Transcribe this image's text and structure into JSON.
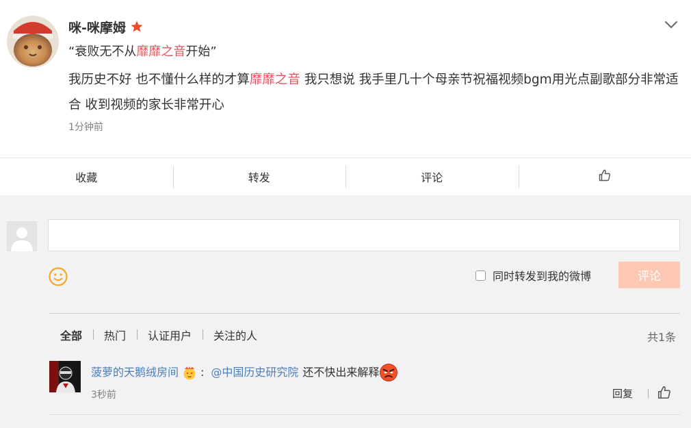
{
  "post": {
    "author": "咪-咪摩姆",
    "title_parts": [
      "“衰败无不从",
      "靡靡之音",
      "开始”"
    ],
    "body_parts": [
      "我历史不好 也不懂什么样的才算",
      "靡靡之音",
      " 我只想说 我手里几十个母亲节祝福视频bgm用光点副歌部分非常适合 收到视频的家长非常开心"
    ],
    "time": "1分钟前",
    "highlight_color": "#e0555d"
  },
  "actions": {
    "favorite": "收藏",
    "repost": "转发",
    "comment": "评论"
  },
  "composer": {
    "input_value": "",
    "repost_label": "同时转发到我的微博",
    "submit_label": "评论",
    "submit_color": "#fcc8b4"
  },
  "filters": {
    "items": [
      "全部",
      "热门",
      "认证用户",
      "关注的人"
    ],
    "active": "全部",
    "count": "共1条"
  },
  "comments": [
    {
      "user": "菠萝的天鹅绒房间",
      "colon": ":",
      "mention": "@中国历史研究院",
      "text": "还不快出来解释",
      "time": "3秒前",
      "reply_label": "回复"
    }
  ],
  "link_color": "#4a7fb8"
}
